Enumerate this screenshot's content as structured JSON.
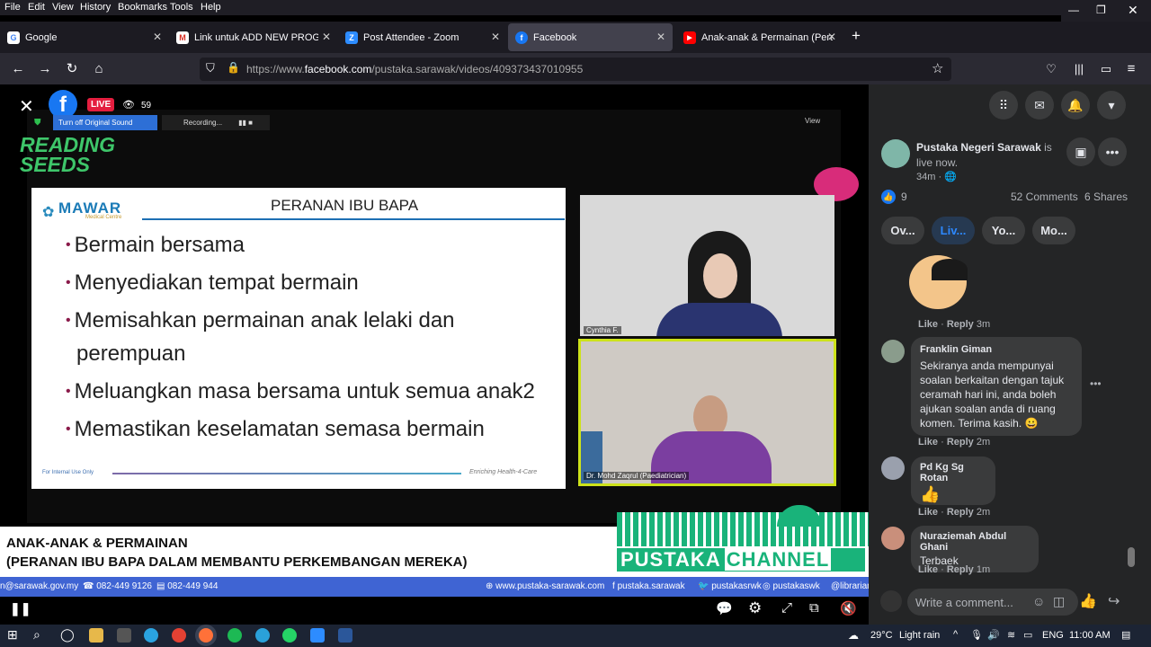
{
  "menu": [
    "File",
    "Edit",
    "View",
    "History",
    "Bookmarks",
    "Tools",
    "Help"
  ],
  "tabs": [
    {
      "title": "Google",
      "favicon": "G",
      "color": "#ffffff",
      "fg": "#4285f4"
    },
    {
      "title": "Link untuk ADD NEW PROGRAM",
      "favicon": "M",
      "color": "#ffffff",
      "fg": "#d93025"
    },
    {
      "title": "Post Attendee - Zoom",
      "favicon": "Z",
      "color": "#2d8cff",
      "fg": "#ffffff"
    },
    {
      "title": "Facebook",
      "favicon": "f",
      "color": "#1877f2",
      "fg": "#ffffff"
    },
    {
      "title": "Anak-anak & Permainan (Peran",
      "favicon": "▶",
      "color": "#ff0000",
      "fg": "#ffffff"
    }
  ],
  "url": {
    "prefix": "https://www.",
    "domain": "facebook.com",
    "path": "/pustaka.sarawak/videos/409373437010955"
  },
  "video": {
    "live_badge": "LIVE",
    "viewers": "59",
    "zoom_sound": "Turn off Original Sound",
    "zoom_recording": "Recording...",
    "zoom_view": "View",
    "reading_seeds_1": "READING",
    "reading_seeds_2": "SEEDS",
    "slide": {
      "logo": "MAWAR",
      "logo_sub": "Medical Centre",
      "title": "PERANAN IBU BAPA",
      "bullets": [
        "Bermain bersama",
        "Menyediakan tempat bermain",
        "Memisahkan permainan anak lelaki dan",
        "perempuan",
        "Meluangkan masa bersama untuk semua anak2",
        "Memastikan keselamatan semasa bermain"
      ],
      "footer_left": "For Internal Use Only",
      "footer_right": "Enriching Health-4-Care"
    },
    "cam1_name": "Cynthia F.",
    "cam2_name": "Dr. Mohd Zaqrul (Paediatrician)",
    "lower_title": "ANAK-ANAK & PERMAINAN",
    "lower_sub": "(PERANAN IBU BAPA DALAM  MEMBANTU PERKEMBANGAN MEREKA)",
    "channel_left": "PUSTAKA",
    "channel_right": "CHANNEL",
    "ticker": {
      "email": "n@sarawak.gov.my",
      "phone": "082-449 9126",
      "fax": "082-449 944",
      "web": "www.pustaka-sarawak.com",
      "fb": "pustaka.sarawak",
      "tw": "pustakasrwk",
      "ig": "pustakaswk",
      "last": "@librarian"
    }
  },
  "fb": {
    "page_name": "Pustaka Negeri Sarawak",
    "is_live": "is",
    "live_now": "live now.",
    "time": "34m",
    "likes": "9",
    "comments": "52 Comments",
    "shares": "6 Shares",
    "filter_tabs": [
      "Ov...",
      "Liv...",
      "Yo...",
      "Mo..."
    ],
    "comments_list": [
      {
        "name": "",
        "text": "",
        "meta": "3m"
      },
      {
        "name": "Franklin Giman",
        "text": "Sekiranya anda mempunyai soalan berkaitan dengan tajuk ceramah hari ini, anda boleh ajukan soalan anda di ruang komen. Terima kasih. 😀",
        "meta": "2m"
      },
      {
        "name": "Pd Kg Sg Rotan",
        "text": "👍",
        "meta": "2m"
      },
      {
        "name": "Nuraziemah Abdul Ghani",
        "text": "Terbaek",
        "meta": "1m"
      }
    ],
    "like_label": "Like",
    "reply_label": "Reply",
    "dot": "·",
    "write_placeholder": "Write a comment..."
  },
  "taskbar": {
    "weather": "29°C",
    "weather_text": "Light rain",
    "lang": "ENG",
    "time": "11:00 AM"
  }
}
